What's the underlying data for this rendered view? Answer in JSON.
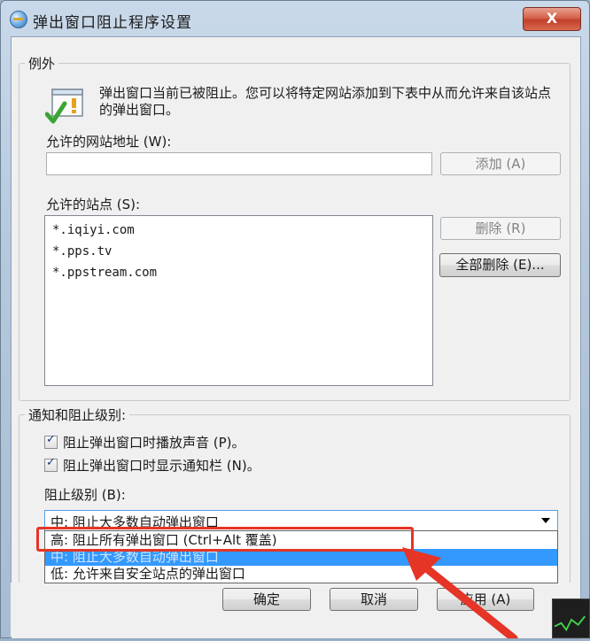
{
  "window": {
    "title": "弹出窗口阻止程序设置",
    "close_label": "X"
  },
  "exceptions": {
    "legend": "例外",
    "info": "弹出窗口当前已被阻止。您可以将特定网站添加到下表中从而允许来自该站点的弹出窗口。",
    "address_label": "允许的网站地址 (W):",
    "address_value": "",
    "add_button": "添加 (A)",
    "allowed_label": "允许的站点 (S):",
    "allowed_sites": [
      "*.iqiyi.com",
      "*.pps.tv",
      "*.ppstream.com"
    ],
    "delete_button": "删除 (R)",
    "delete_all_button": "全部删除 (E)..."
  },
  "notifications": {
    "legend": "通知和阻止级别:",
    "play_sound": {
      "label": "阻止弹出窗口时播放声音 (P)。",
      "checked": true
    },
    "show_bar": {
      "label": "阻止弹出窗口时显示通知栏 (N)。",
      "checked": true
    },
    "level_label": "阻止级别 (B):",
    "level_selected": "中: 阻止大多数自动弹出窗口",
    "level_options": [
      "高: 阻止所有弹出窗口 (Ctrl+Alt 覆盖)",
      "中: 阻止大多数自动弹出窗口",
      "低: 允许来自安全站点的弹出窗口"
    ]
  },
  "footer": {
    "ok": "确定",
    "cancel": "取消",
    "apply": "应用 (A)"
  },
  "annotation": {
    "color": "#e53526"
  }
}
